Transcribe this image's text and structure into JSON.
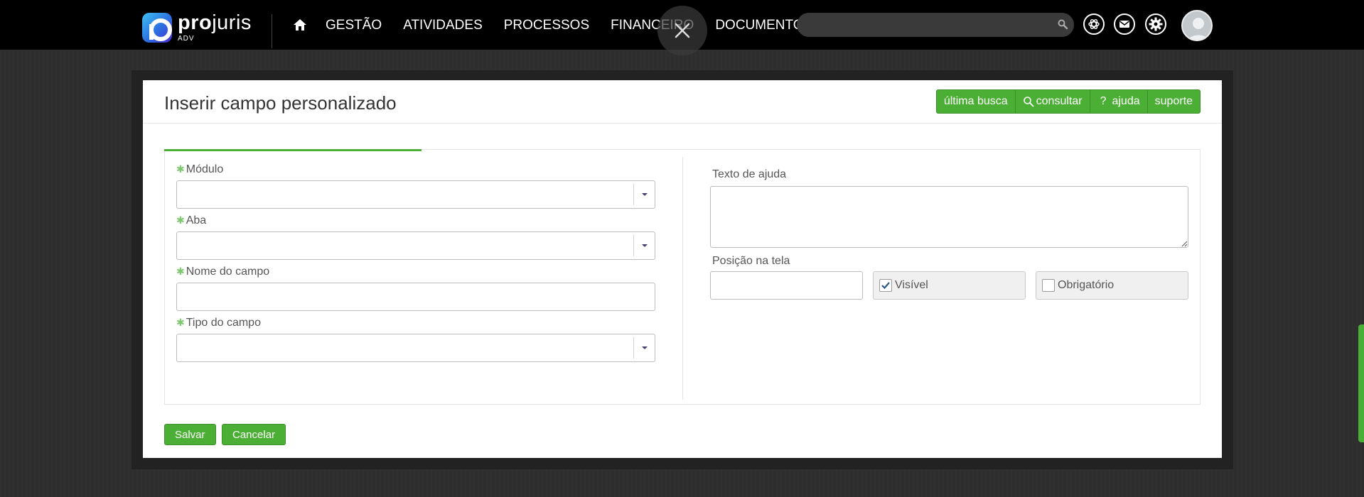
{
  "brand": {
    "name_bold": "pro",
    "name_regular": "juris",
    "sub": "ADV",
    "accent": "#4caf35"
  },
  "nav": {
    "home_icon": "home-icon",
    "items": [
      "GESTÃO",
      "ATIVIDADES",
      "PROCESSOS",
      "FINANCEIRO",
      "DOCUMENTOS"
    ]
  },
  "search": {
    "placeholder": "",
    "icon": "search-icon"
  },
  "topbar_icons": [
    "openai-icon",
    "mail-icon",
    "gear-icon"
  ],
  "modal": {
    "title": "Inserir campo personalizado",
    "header_buttons": {
      "ultima_busca": "última busca",
      "consultar": "consultar",
      "ajuda_symbol": "?",
      "ajuda": "ajuda",
      "suporte": "suporte"
    },
    "left": {
      "modulo_label": "Módulo",
      "aba_label": "Aba",
      "nome_label": "Nome do campo",
      "tipo_label": "Tipo do campo",
      "modulo_value": "",
      "aba_value": "",
      "nome_value": "",
      "tipo_value": ""
    },
    "right": {
      "texto_ajuda_label": "Texto de ajuda",
      "texto_ajuda_value": "",
      "posicao_label": "Posição na tela",
      "posicao_value": "",
      "visivel_label": "Visível",
      "visivel_checked": true,
      "obrigatorio_label": "Obrigatório",
      "obrigatorio_checked": false
    },
    "footer": {
      "save": "Salvar",
      "cancel": "Cancelar"
    }
  }
}
